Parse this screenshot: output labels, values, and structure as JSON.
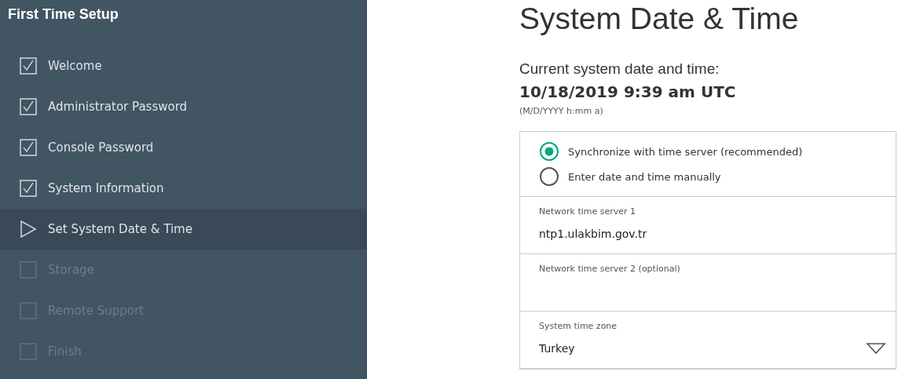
{
  "sidebar": {
    "title": "First Time Setup",
    "steps": [
      {
        "label": "Welcome",
        "kind": "done",
        "selected": false
      },
      {
        "label": "Administrator Password",
        "kind": "done",
        "selected": false
      },
      {
        "label": "Console Password",
        "kind": "done",
        "selected": false
      },
      {
        "label": "System Information",
        "kind": "done",
        "selected": false
      },
      {
        "label": "Set System Date & Time",
        "kind": "current",
        "selected": true
      },
      {
        "label": "Storage",
        "kind": "pending",
        "selected": false
      },
      {
        "label": "Remote Support",
        "kind": "pending",
        "selected": false
      },
      {
        "label": "Finish",
        "kind": "pending",
        "selected": false
      }
    ]
  },
  "main": {
    "heading": "System Date & Time",
    "current_label": "Current system date and time:",
    "current_value": "10/18/2019 9:39 am UTC",
    "format_hint": "(M/D/YYYY h:mm a)",
    "sync_options": [
      {
        "label": "Synchronize with time server (recommended)",
        "selected": true
      },
      {
        "label": "Enter date and time manually",
        "selected": false
      }
    ],
    "fields": [
      {
        "label": "Network time server 1",
        "value": "ntp1.ulakbim.gov.tr"
      },
      {
        "label": "Network time server 2 (optional)"
      }
    ],
    "time_zone": {
      "label": "System time zone",
      "value": "Turkey"
    }
  }
}
